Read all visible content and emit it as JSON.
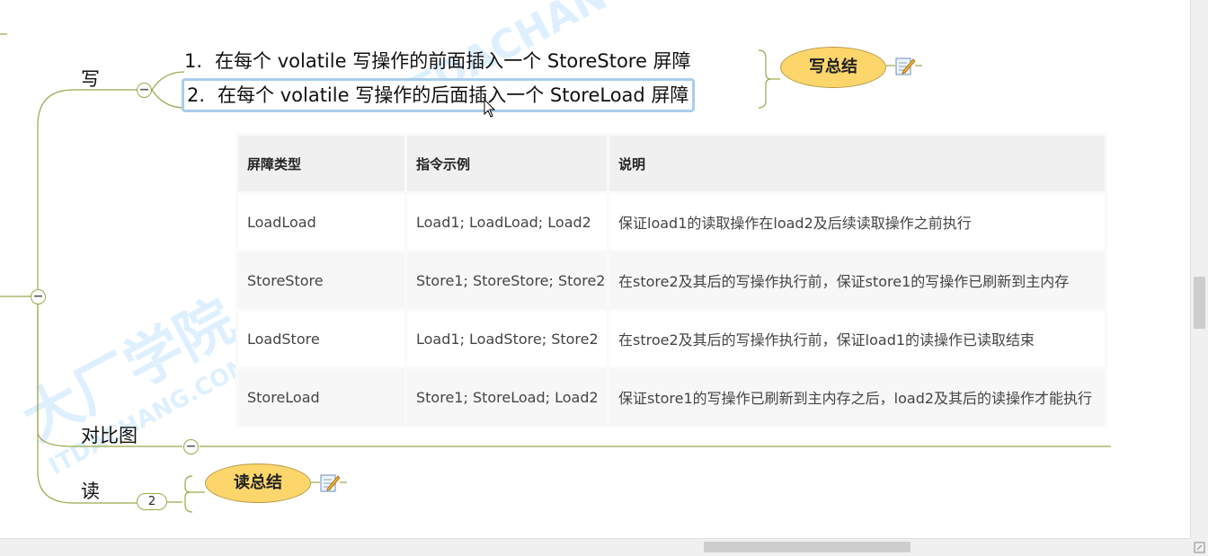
{
  "branches": {
    "write": {
      "label": "写",
      "summary": "写总结"
    },
    "compare": {
      "label": "对比图"
    },
    "read": {
      "label": "读",
      "summary": "读总结",
      "collapsed_count": "2"
    }
  },
  "write_topics": [
    {
      "num": "1.",
      "text": "在每个 volatile 写操作的前面插入一个 StoreStore 屏障"
    },
    {
      "num": "2.",
      "text": "在每个 volatile 写操作的后面插入一个 StoreLoad 屏障"
    }
  ],
  "collapse_symbol": "−",
  "table": {
    "headers": [
      "屏障类型",
      "指令示例",
      "说明"
    ],
    "rows": [
      [
        "LoadLoad",
        "Load1; LoadLoad; Load2",
        "保证load1的读取操作在load2及后续读取操作之前执行"
      ],
      [
        "StoreStore",
        "Store1; StoreStore; Store2",
        "在store2及其后的写操作执行前，保证store1的写操作已刷新到主内存"
      ],
      [
        "LoadStore",
        "Load1; LoadStore; Store2",
        "在stroe2及其后的写操作执行前，保证load1的读操作已读取结束"
      ],
      [
        "StoreLoad",
        "Store1; StoreLoad; Load2",
        "保证store1的写操作已刷新到主内存之后，load2及其后的读操作才能执行"
      ]
    ]
  },
  "watermarks": [
    {
      "text": "大厂学院",
      "sub": "ITDACHANG.COM"
    }
  ],
  "colors": {
    "branch_line": "#9aa84a",
    "summary_fill": "#fcd66b",
    "selection": "#a9cdec"
  },
  "icons": {
    "note": "note-pencil-icon",
    "cursor": "mouse-cursor-icon"
  }
}
